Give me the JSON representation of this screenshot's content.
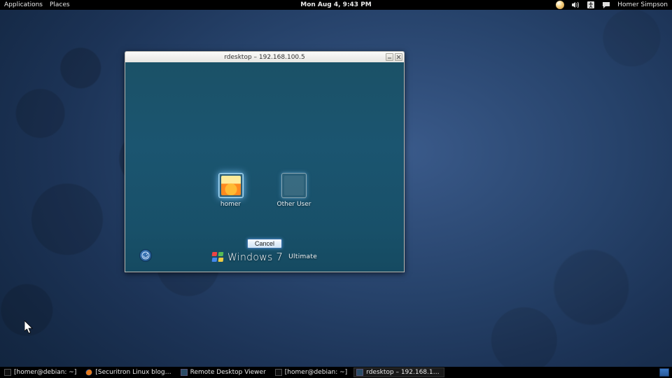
{
  "topbar": {
    "applications": "Applications",
    "places": "Places",
    "clock": "Mon Aug  4,  9:43 PM",
    "username": "Homer Simpson"
  },
  "rdp": {
    "title": "rdesktop – 192.168.100.5",
    "users": {
      "homer": "homer",
      "other": "Other User"
    },
    "cancel": "Cancel",
    "brand_os": "Windows",
    "brand_ver": "7",
    "brand_edition": "Ultimate"
  },
  "taskbar": {
    "items": [
      "[homer@debian: ~]",
      "[Securitron Linux blog…",
      "Remote Desktop Viewer",
      "[homer@debian: ~]",
      "rdesktop – 192.168.1…"
    ]
  }
}
